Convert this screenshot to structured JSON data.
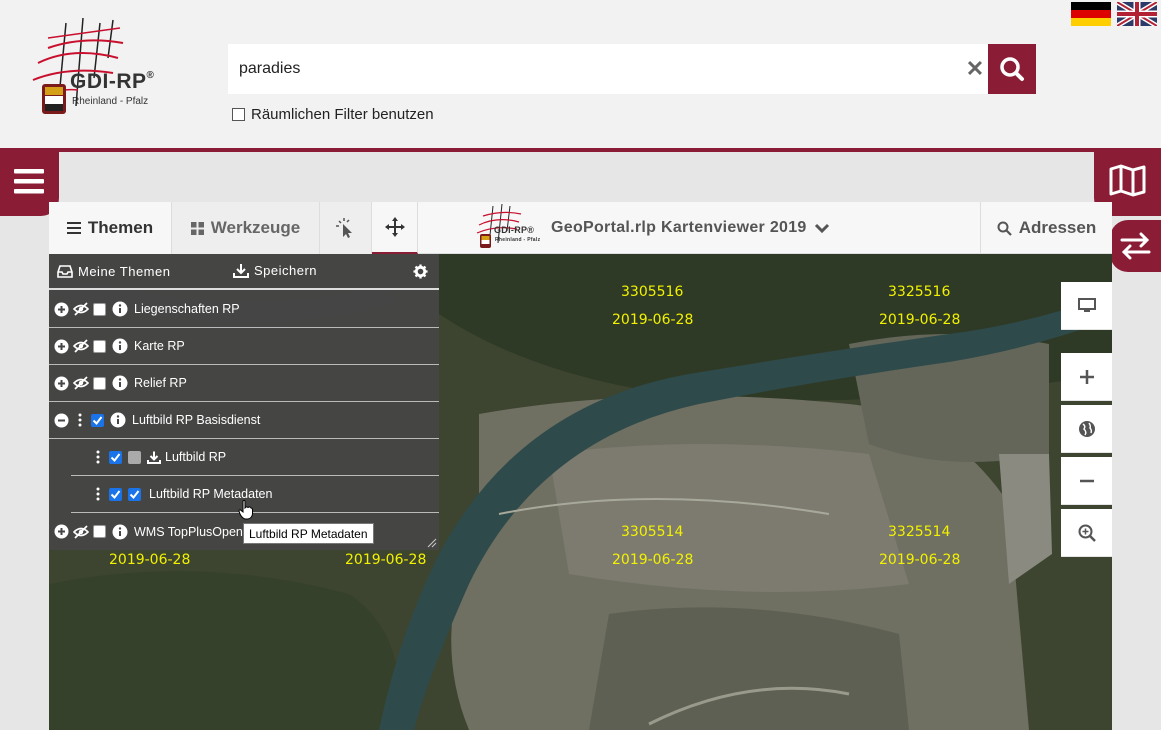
{
  "header": {
    "logo": {
      "title": "GDI-RP",
      "registered": "®",
      "subtitle": "Rheinland - Pfalz"
    },
    "languages": [
      {
        "name": "german-flag"
      },
      {
        "name": "uk-flag"
      }
    ],
    "search": {
      "value": "paradies",
      "clear_label": "✕"
    },
    "spatial_filter": {
      "label": "Räumlichen Filter benutzen",
      "checked": false
    }
  },
  "toolbar": {
    "themen_label": "Themen",
    "werkzeuge_label": "Werkzeuge",
    "viewer_title": "GeoPortal.rlp Kartenviewer 2019",
    "adressen_label": "Adressen",
    "mini_logo_title": "GDI-RP",
    "mini_logo_subtitle": "Rheinland - Pfalz"
  },
  "panel": {
    "meine_themen_label": "Meine Themen",
    "speichern_label": "Speichern",
    "layers": [
      {
        "name": "Liegenschaften RP",
        "expanded": false,
        "checked": false
      },
      {
        "name": "Karte RP",
        "expanded": false,
        "checked": false
      },
      {
        "name": "Relief RP",
        "expanded": false,
        "checked": false
      },
      {
        "name": "Luftbild RP Basisdienst",
        "expanded": true,
        "checked": true
      },
      {
        "name": "Luftbild RP",
        "sublayer": true,
        "checked": true
      },
      {
        "name": "Luftbild RP Metadaten",
        "sublayer": true,
        "checked": true
      },
      {
        "name": "WMS TopPlusOpen",
        "expanded": false,
        "checked": false
      }
    ],
    "tooltip": "Luftbild RP Metadaten"
  },
  "map": {
    "labels": [
      {
        "id": "3305516",
        "date": "2019-06-28"
      },
      {
        "id": "3325516",
        "date": "2019-06-28"
      },
      {
        "id": "3305514",
        "date": "2019-06-28"
      },
      {
        "id": "3325514",
        "date": "2019-06-28"
      },
      {
        "date": "2019-06-28"
      },
      {
        "date": "2019-06-28"
      }
    ]
  },
  "colors": {
    "brand": "#8b1c35",
    "label": "#f2f200"
  }
}
